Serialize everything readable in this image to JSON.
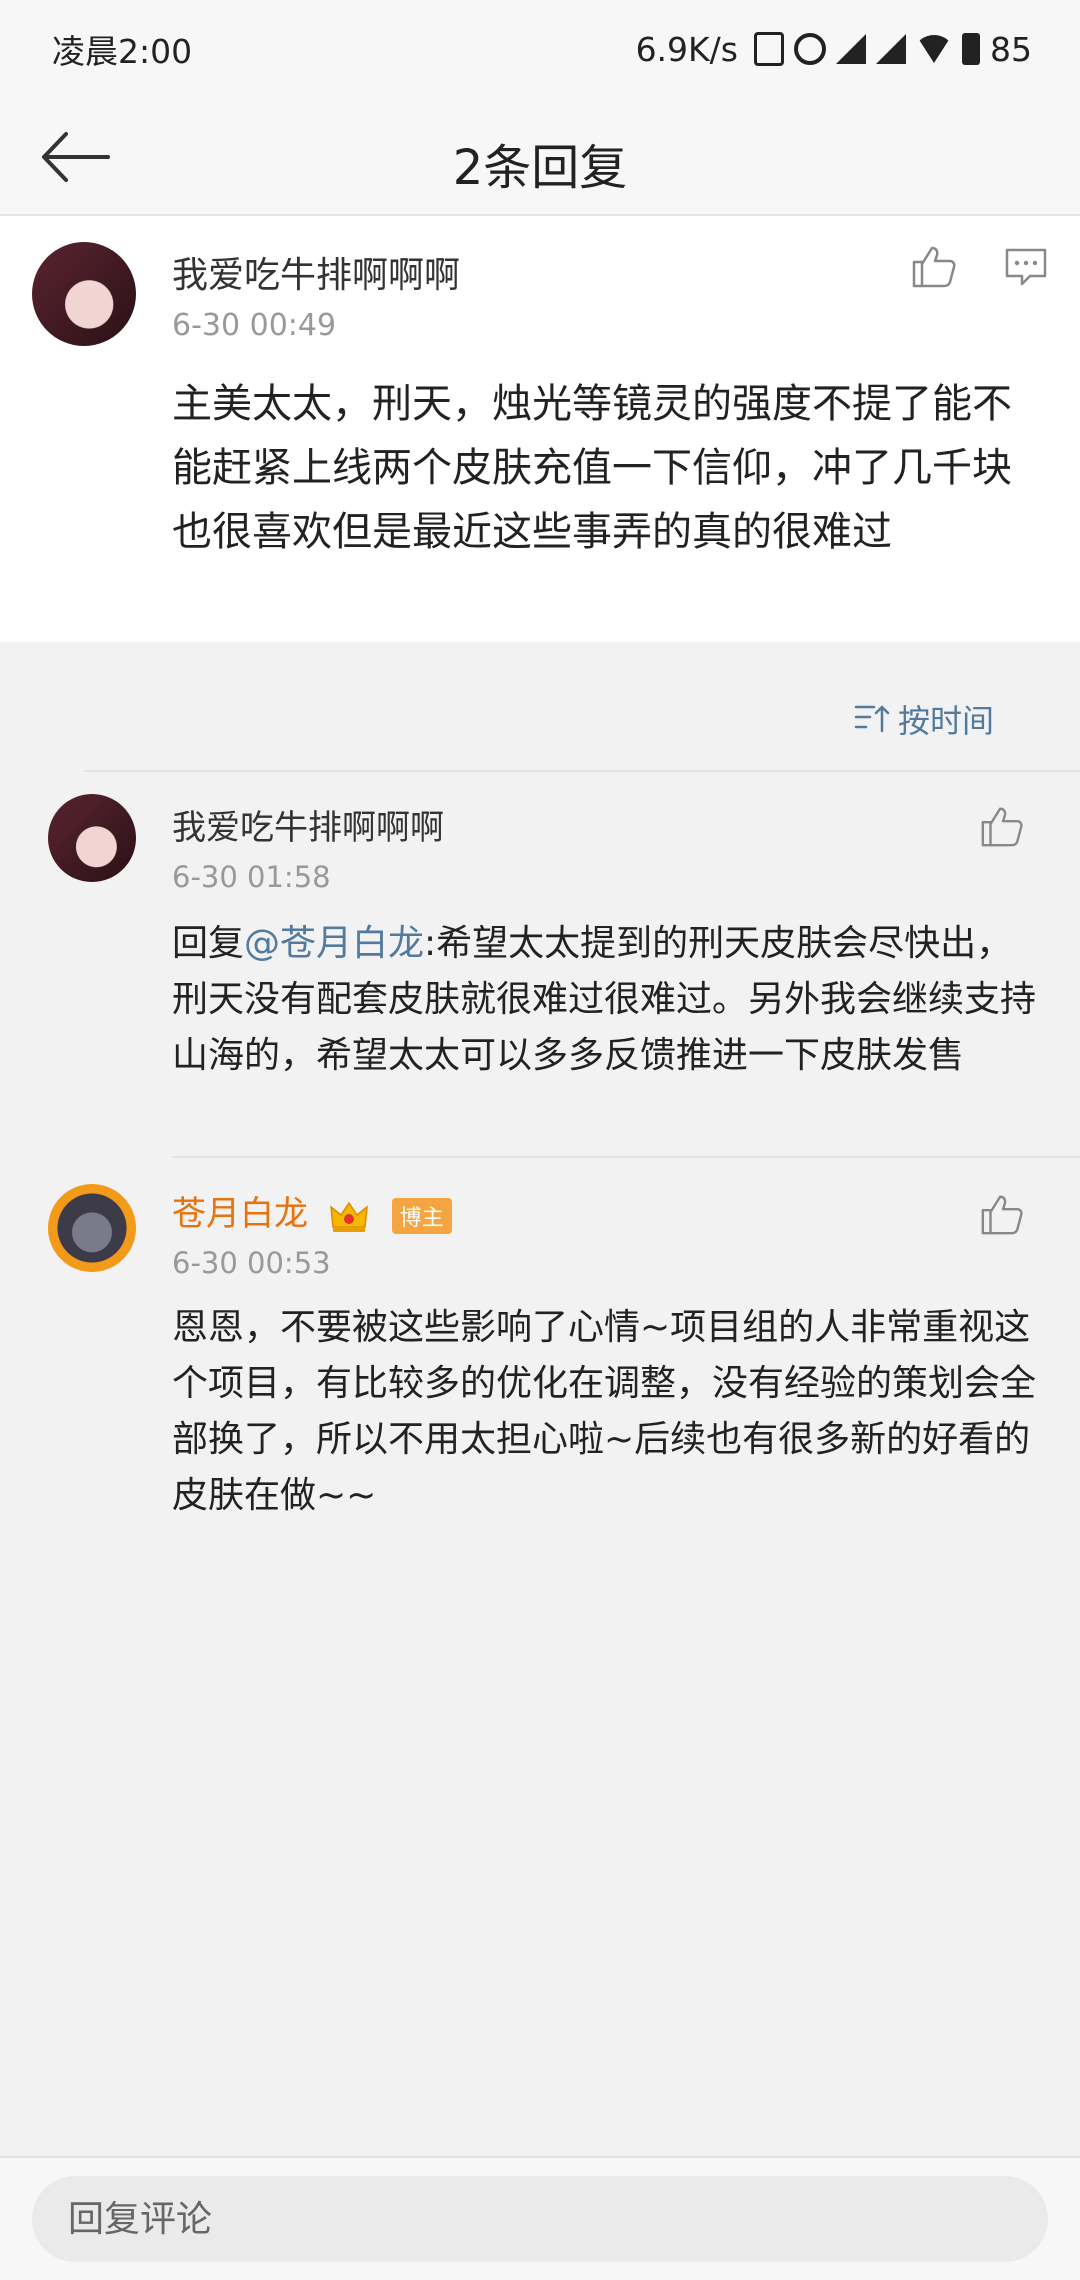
{
  "status_bar": {
    "time": "凌晨2:00",
    "network_speed": "6.9K/s",
    "battery": "85"
  },
  "header": {
    "title": "2条回复"
  },
  "main_comment": {
    "author": "我爱吃牛排啊啊啊",
    "time": "6-30 00:49",
    "text": "主美太太，刑天，烛光等镜灵的强度不提了能不能赶紧上线两个皮肤充值一下信仰，冲了几千块也很喜欢但是最近这些事弄的真的很难过"
  },
  "sort": {
    "label": "按时间"
  },
  "replies": [
    {
      "author": "我爱吃牛排啊啊啊",
      "time": "6-30 01:58",
      "reply_prefix": "回复",
      "mention": "@苍月白龙",
      "text": ":希望太太提到的刑天皮肤会尽快出，刑天没有配套皮肤就很难过很难过。另外我会继续支持山海的，希望太太可以多多反馈推进一下皮肤发售"
    },
    {
      "author": "苍月白龙",
      "badge": "博主",
      "time": "6-30 00:53",
      "text": "恩恩，不要被这些影响了心情~项目组的人非常重视这个项目，有比较多的优化在调整，没有经验的策划会全部换了，所以不用太担心啦~后续也有很多新的好看的皮肤在做~~"
    }
  ],
  "bottom": {
    "placeholder": "回复评论"
  },
  "colors": {
    "mention": "#517a9e",
    "vip_name": "#e8720c",
    "badge": "#f4a541"
  }
}
